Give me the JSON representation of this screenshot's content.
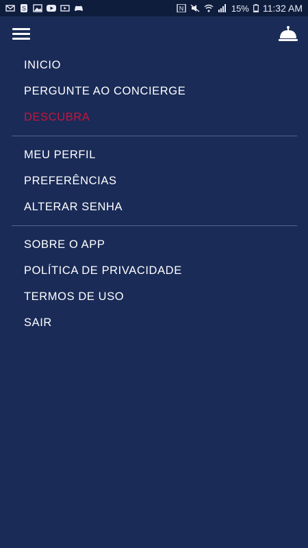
{
  "status_bar": {
    "battery": "15%",
    "time": "11:32 AM"
  },
  "header": {
    "menu_icon": "hamburger-menu-icon",
    "bell_icon": "concierge-bell-icon"
  },
  "menu": {
    "primary": [
      {
        "label": "INICIO"
      },
      {
        "label": "PERGUNTE AO CONCIERGE"
      },
      {
        "label": "DESCUBRA",
        "active": true
      }
    ],
    "account": [
      {
        "label": "MEU PERFIL"
      },
      {
        "label": "PREFERÊNCIAS"
      },
      {
        "label": "ALTERAR SENHA"
      }
    ],
    "about": [
      {
        "label": "SOBRE O APP"
      },
      {
        "label": "POLÍTICA DE PRIVACIDADE"
      },
      {
        "label": "TERMOS DE USO"
      },
      {
        "label": "SAIR"
      }
    ]
  },
  "colors": {
    "background": "#1a2b57",
    "accent": "#c8153c",
    "text": "#ffffff",
    "divider": "#55658c"
  }
}
